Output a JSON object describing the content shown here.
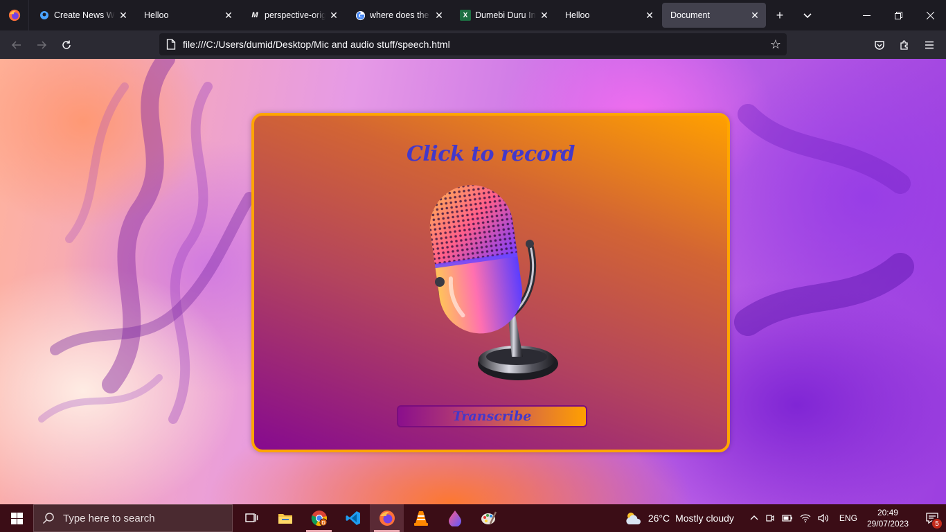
{
  "browser": {
    "tabs": [
      {
        "title": "Create News Web",
        "icon": "github-copilot-icon",
        "fade": true
      },
      {
        "title": "Helloo",
        "icon": "none",
        "fade": false
      },
      {
        "title": "perspective-origin",
        "icon": "mdn-icon",
        "fade": true
      },
      {
        "title": "where does the as",
        "icon": "google-icon",
        "fade": true
      },
      {
        "title": "Dumebi Duru Inte",
        "icon": "excel-icon",
        "fade": true
      },
      {
        "title": "Helloo",
        "icon": "none",
        "fade": false
      },
      {
        "title": "Document",
        "icon": "none",
        "fade": false,
        "active": true
      }
    ],
    "url": "file:///C:/Users/dumid/Desktop/Mic and audio stuff/speech.html"
  },
  "page": {
    "title": "Click to record",
    "button_label": "Transcribe",
    "colors": {
      "card_border": "#ffa500",
      "title_color": "#4338ca",
      "card_gradient_start": "#860a8f",
      "card_gradient_end": "#ffa000"
    }
  },
  "taskbar": {
    "search_placeholder": "Type here to search",
    "apps": [
      "task-view-icon",
      "file-explorer-icon",
      "chrome-icon",
      "vscode-icon",
      "firefox-icon",
      "vlc-icon",
      "app-droplet-icon",
      "paint-icon"
    ],
    "weather": {
      "temp": "26°C",
      "condition": "Mostly cloudy"
    },
    "language": "ENG",
    "time": "20:49",
    "date": "29/07/2023",
    "notification_count": "5"
  }
}
